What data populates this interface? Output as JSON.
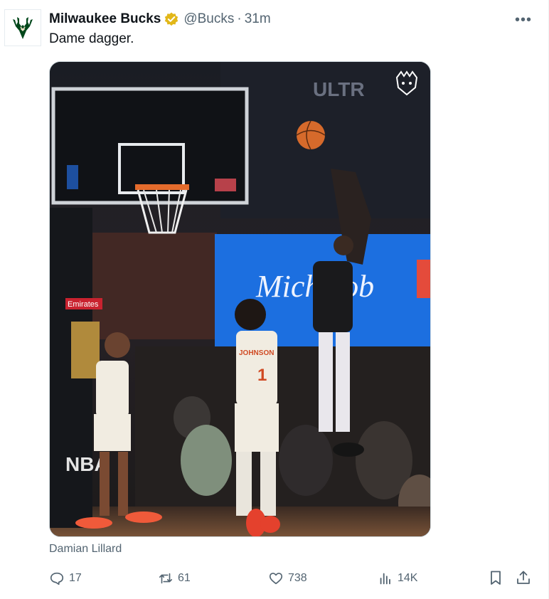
{
  "author": {
    "name": "Milwaukee Bucks",
    "handle": "@Bucks",
    "separator": "·",
    "time": "31m",
    "verified": true,
    "avatar_icon": "bucks-logo-icon",
    "brand_color": "#00471b"
  },
  "tweet": {
    "text": "Dame dagger."
  },
  "media": {
    "caption": "Damian Lillard",
    "jersey_name": "JOHNSON",
    "jersey_number": "1",
    "signage": {
      "emirates": "Emirates",
      "nba": "NBA",
      "ultra": "ULTR",
      "michelob": "Michelob"
    }
  },
  "actions": {
    "reply_count": "17",
    "retweet_count": "61",
    "like_count": "738",
    "views_count": "14K",
    "icons": [
      "reply-icon",
      "retweet-icon",
      "like-icon",
      "views-icon",
      "bookmark-icon",
      "share-icon"
    ]
  },
  "colors": {
    "text_primary": "#0f1419",
    "text_secondary": "#536471",
    "verified_gold": "#e2b719",
    "border": "#cfd9de"
  }
}
